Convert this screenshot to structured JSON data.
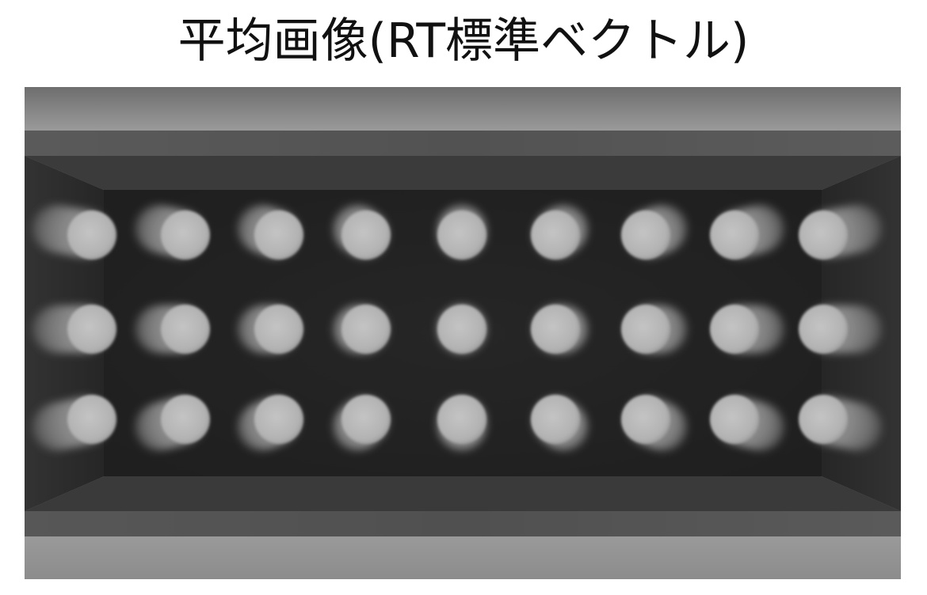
{
  "figure": {
    "title": "平均画像(RT標準ベクトル)"
  },
  "image": {
    "kind": "averaged grayscale image of a 3 x 9 array of cylindrical rods viewed from above inside a rectangular box",
    "rows": 3,
    "columns": 9
  }
}
